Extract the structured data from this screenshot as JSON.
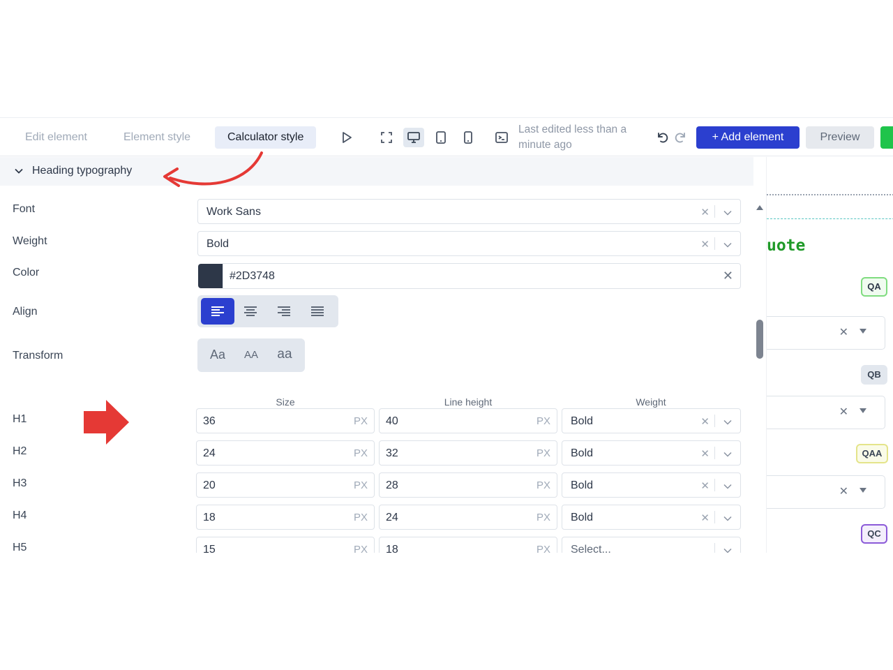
{
  "toolbar": {
    "tabs": [
      "Edit element",
      "Element style",
      "Calculator style"
    ],
    "status": "Last edited less than a minute ago",
    "add_label": "+ Add element",
    "preview_label": "Preview"
  },
  "section": {
    "title": "Heading typography"
  },
  "fields": {
    "font": {
      "label": "Font",
      "value": "Work Sans"
    },
    "weight": {
      "label": "Weight",
      "value": "Bold"
    },
    "color": {
      "label": "Color",
      "value": "#2D3748",
      "swatch": "#2D3748"
    },
    "align": {
      "label": "Align",
      "options": [
        "left",
        "center",
        "right",
        "justify"
      ],
      "selected": "left"
    },
    "transform": {
      "label": "Transform",
      "options": [
        "Aa",
        "AA",
        "aa"
      ]
    }
  },
  "columns": {
    "size": "Size",
    "line_height": "Line height",
    "weight": "Weight"
  },
  "unit": "PX",
  "headings": [
    {
      "label": "H1",
      "size": "36",
      "line_height": "40",
      "weight": "Bold"
    },
    {
      "label": "H2",
      "size": "24",
      "line_height": "32",
      "weight": "Bold"
    },
    {
      "label": "H3",
      "size": "20",
      "line_height": "28",
      "weight": "Bold"
    },
    {
      "label": "H4",
      "size": "18",
      "line_height": "24",
      "weight": "Bold"
    },
    {
      "label": "H5",
      "size": "15",
      "line_height": "18",
      "weight": "Select..."
    }
  ],
  "preview": {
    "heading_text": "uote",
    "badges": [
      "QA",
      "QB",
      "QAA",
      "QC"
    ]
  },
  "colors": {
    "accent": "#2B3FCF",
    "green": "#1FC44B",
    "annotation": "#E53935"
  }
}
